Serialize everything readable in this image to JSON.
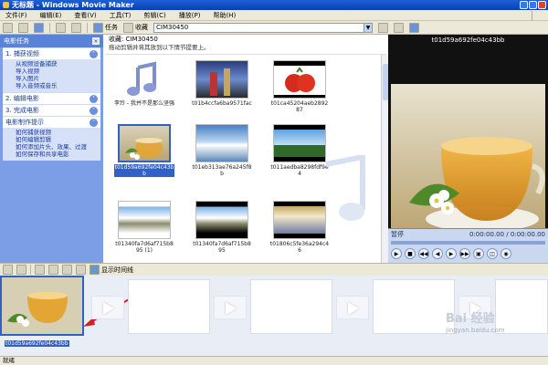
{
  "window": {
    "title": "无标题 - Windows Movie Maker"
  },
  "menu": [
    "文件(F)",
    "编辑(E)",
    "查看(V)",
    "工具(T)",
    "剪辑(C)",
    "播放(P)",
    "帮助(H)"
  ],
  "toolbar": {
    "tasks_label": "任务",
    "collections_label": "收藏",
    "collection_value": "CIM30450"
  },
  "taskpane": {
    "title": "电影任务",
    "sections": [
      {
        "title": "1. 捕获视频",
        "links": [
          "从视频设备捕获",
          "导入视频",
          "导入图片",
          "导入音频或音乐"
        ]
      },
      {
        "title": "2. 编辑电影",
        "links": []
      },
      {
        "title": "3. 完成电影",
        "links": []
      },
      {
        "title": "电影制作提示",
        "links": [
          "如何捕获视频",
          "如何编辑剪辑",
          "如何添加片头、效果、过渡",
          "如何保存和共享电影"
        ]
      }
    ]
  },
  "content_header": {
    "title": "收藏: CIM30450",
    "hint": "拖动剪辑并将其放到以下情节提要上。"
  },
  "clips": [
    {
      "caption": "李玲 - 我并不是那么坚强"
    },
    {
      "caption": "t01b4ccfa6ba9571fac"
    },
    {
      "caption": "t01ca45204aeb289287"
    },
    {
      "caption": "t01d59a692fe04c43bb"
    },
    {
      "caption": "t01eb313ae76a245f8b"
    },
    {
      "caption": "t011aedba8298fdf9e4"
    },
    {
      "caption": "t01340fa7d6af715b895 (1)"
    },
    {
      "caption": "t01340fa7d6af715b895"
    },
    {
      "caption": "t01806c5fe36a294c46"
    }
  ],
  "monitor": {
    "title": "t01d59a692fe04c43bb",
    "status": "暂停",
    "time": "0:00:00.00 / 0:00:00.00"
  },
  "timeline": {
    "show_timeline_label": "显示时间线"
  },
  "storyboard": {
    "first_caption": "t01d59a692fe04c43bb"
  },
  "statusbar": {
    "text": "就绪"
  },
  "watermark": {
    "brand": "Bai 经验",
    "url": "jingyan.baidu.com"
  }
}
